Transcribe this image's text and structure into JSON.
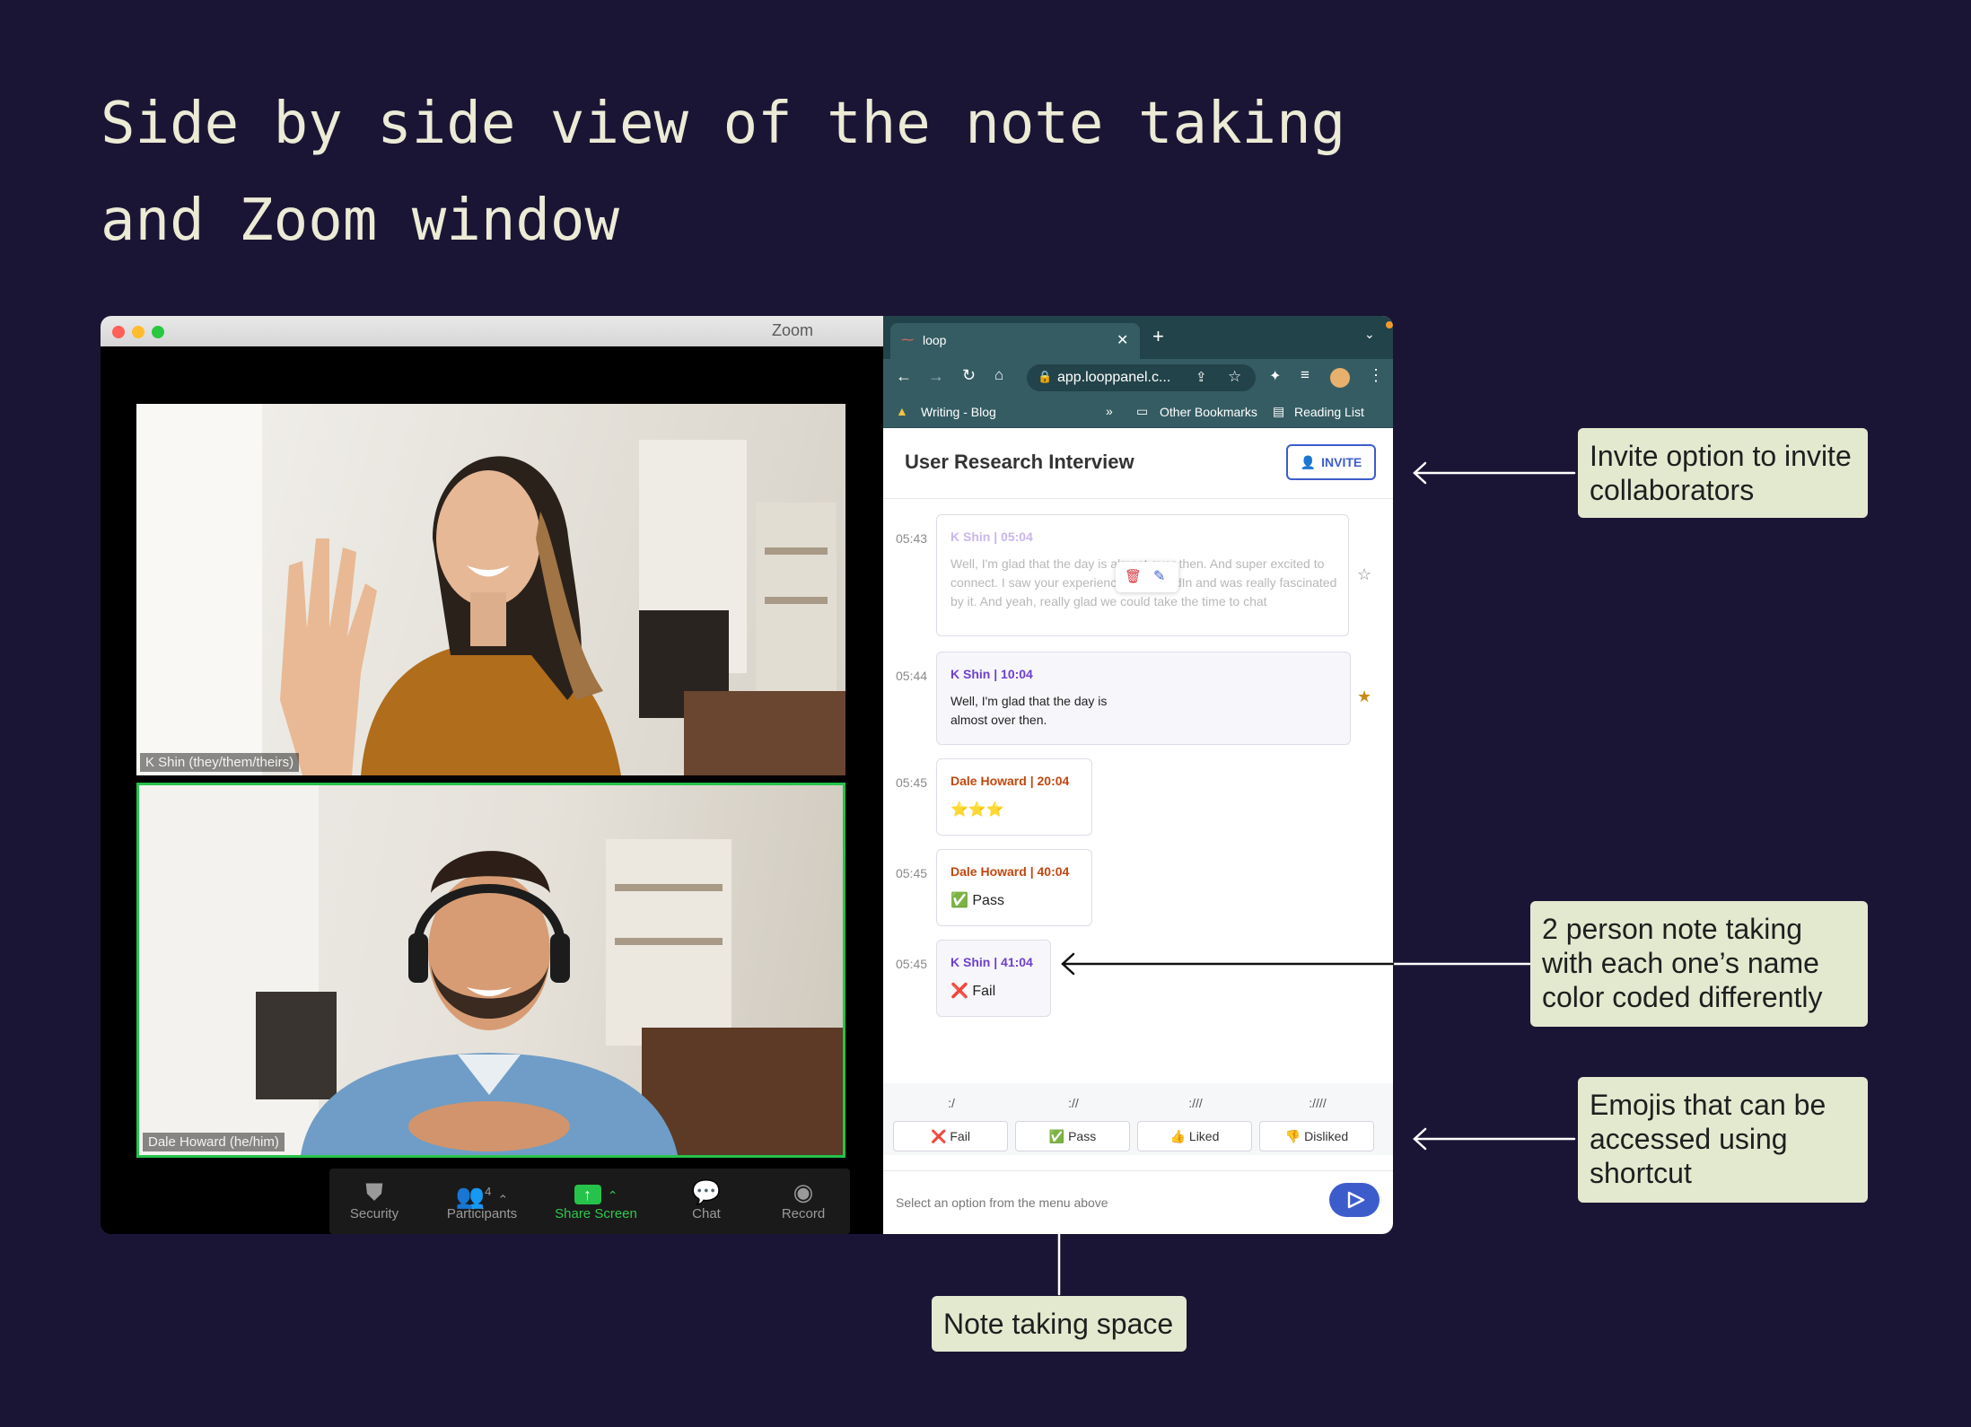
{
  "heading": [
    "Side by side view of the note taking",
    "and Zoom window"
  ],
  "zoom": {
    "window_title": "Zoom",
    "participants": [
      {
        "label": "K Shin (they/them/theirs)"
      },
      {
        "label": "Dale Howard (he/him)"
      }
    ],
    "toolbar": [
      {
        "label": "Security",
        "icon": "shield-icon"
      },
      {
        "label": "Participants",
        "icon": "people-icon",
        "count": "4"
      },
      {
        "label": "Share Screen",
        "icon": "share-screen-icon"
      },
      {
        "label": "Chat",
        "icon": "chat-icon"
      },
      {
        "label": "Record",
        "icon": "record-icon"
      }
    ]
  },
  "browser": {
    "tab_title": "loop",
    "url": "app.looppanel.c...",
    "bookmarks": [
      "Writing - Blog",
      "»",
      "Other Bookmarks",
      "Reading List"
    ]
  },
  "app": {
    "title": "User Research Interview",
    "invite_label": "INVITE",
    "notes": [
      {
        "time": "05:43",
        "author": "K Shin | 05:04",
        "text": "Well, I'm glad that the day is almost over then. And super excited to connect. I saw your experience on LinkedIn and was really fascinated by it. And yeah, really glad we could take the time to chat",
        "starred": false,
        "color": "#c9b6ea"
      },
      {
        "time": "05:44",
        "author": "K Shin | 10:04",
        "text": "Well, I'm glad that the day is almost over then.",
        "starred": true,
        "color": "#6e3fcf"
      },
      {
        "time": "05:45",
        "author": "Dale Howard | 20:04",
        "text": "⭐⭐⭐",
        "color": "#c2470e"
      },
      {
        "time": "05:45",
        "author": "Dale Howard | 40:04",
        "text": "✅ Pass",
        "color": "#c2470e"
      },
      {
        "time": "05:45",
        "author": "K Shin | 41:04",
        "text": "❌ Fail",
        "color": "#6e3fcf"
      }
    ],
    "shortcuts": [
      ":/",
      "://",
      ":///",
      ":////"
    ],
    "quick_tags": [
      "❌ Fail",
      "✅ Pass",
      "👍 Liked",
      "👎 Disliked"
    ],
    "input_placeholder": "Select an option from the menu above"
  },
  "callouts": {
    "invite": "Invite option to invite collaborators",
    "notes": "2 person note taking with each one’s name color coded differently",
    "emoji": "Emojis that can be accessed using shortcut",
    "space": "Note taking space"
  },
  "colors": {
    "background": "#1b1535",
    "callout": "#e3e9cf",
    "accent": "#3d5ccc",
    "zoom_green": "#26c34a"
  }
}
